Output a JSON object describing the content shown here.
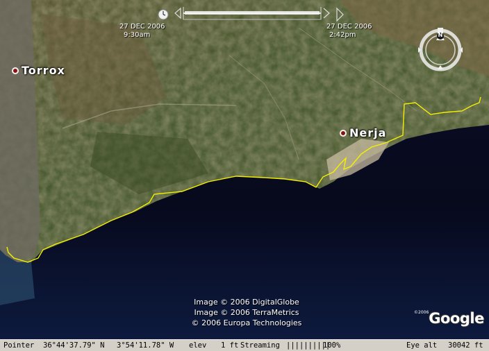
{
  "time_slider": {
    "start_date": "27 DEC 2006",
    "start_time": "9:30am",
    "end_date": "27 DEC 2006",
    "end_time": "2:42pm"
  },
  "places": [
    {
      "name": "Torrox"
    },
    {
      "name": "Nerja"
    }
  ],
  "compass": {
    "north_label": "N"
  },
  "attribution": [
    "Image © 2006 DigitalGlobe",
    "Image © 2006 TerraMetrics",
    "© 2006 Europa Technologies"
  ],
  "logo": {
    "year": "©2006",
    "text": "Google"
  },
  "status_bar": {
    "pointer_label": "Pointer",
    "latitude": "36°44'37.79\" N",
    "longitude": "3°54'11.78\" W",
    "elev_label": "elev",
    "elev_value": "1 ft",
    "streaming_label": "Streaming",
    "streaming_bars": "||||||||||",
    "streaming_percent": "100%",
    "eye_alt_label": "Eye alt",
    "eye_alt_value": "30042 ft"
  },
  "colors": {
    "sea": "#07091c",
    "land": "#4a5a2c",
    "mountain": "#6b5a3a",
    "track": "#f4f000",
    "town": "#c8bba0"
  },
  "icons": {
    "clock": "clock-icon",
    "slider_left": "slider-left-arrow-icon",
    "slider_right": "slider-right-arrow-icon",
    "compass": "compass-icon",
    "place_marker": "place-dot-icon"
  }
}
